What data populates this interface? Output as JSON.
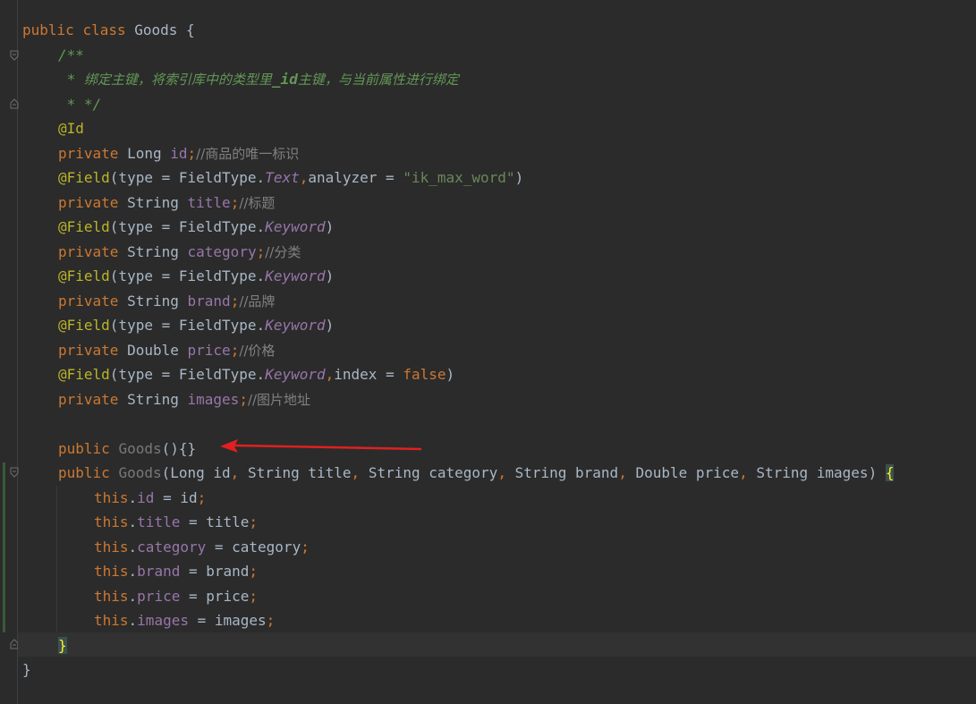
{
  "code": {
    "class_kw_public": "public",
    "class_kw_class": "class",
    "class_name": "Goods",
    "open_brace": " {",
    "doc_open": "/**",
    "doc_line_star": " * ",
    "doc_text_1": "绑定主键，将索引库中的类型里",
    "doc_id": "_id",
    "doc_text_2": "主键，与当前属性进行绑定",
    "doc_close": " * */",
    "ann_id": "@Id",
    "f_id_type": "Long",
    "f_id_name": "id",
    "f_id_comment": "//商品的唯一标识",
    "ann_field_text_prefix": "(type = FieldType.",
    "ann_field_text_val": "Text",
    "ann_field_text_mid": "analyzer = ",
    "ann_field_text_str": "\"ik_max_word\"",
    "f_title_type": "String",
    "f_title_name": "title",
    "f_title_comment": "//标题",
    "ann_keyword_val": "Keyword",
    "f_category_type": "String",
    "f_category_name": "category",
    "f_category_comment": "//分类",
    "f_brand_type": "String",
    "f_brand_name": "brand",
    "f_brand_comment": "//品牌",
    "f_price_type": "Double",
    "f_price_name": "price",
    "f_price_comment": "//价格",
    "ann_index_mid": "index = ",
    "ann_index_false": "false",
    "f_images_type": "String",
    "f_images_name": "images",
    "f_images_comment": "//图片地址",
    "ctor_empty_rest": "(){}",
    "ctor_params": "(Long id",
    "ctor_p2": " String title",
    "ctor_p3": " String category",
    "ctor_p4": " String brand",
    "ctor_p5": " Double price",
    "ctor_p6": " String images) ",
    "kw_private": "private",
    "kw_this": "this",
    "ann_field": "@Field",
    "assign_id": " = id",
    "assign_title": " = title",
    "assign_category": " = category",
    "assign_brand": " = brand",
    "assign_price": " = price",
    "assign_images": " = images",
    "close_brace": "}",
    "brace_open_only": "{"
  },
  "colors": {
    "background": "#2b2b2b",
    "keyword": "#cc7832",
    "annotation": "#bbb529",
    "field": "#9876aa",
    "string": "#6a8759",
    "comment": "#808080",
    "doc_comment": "#629755",
    "arrow": "#e02020"
  },
  "icons": {
    "fold_marker": "fold-marker-icon",
    "arrow": "red-arrow-icon"
  }
}
